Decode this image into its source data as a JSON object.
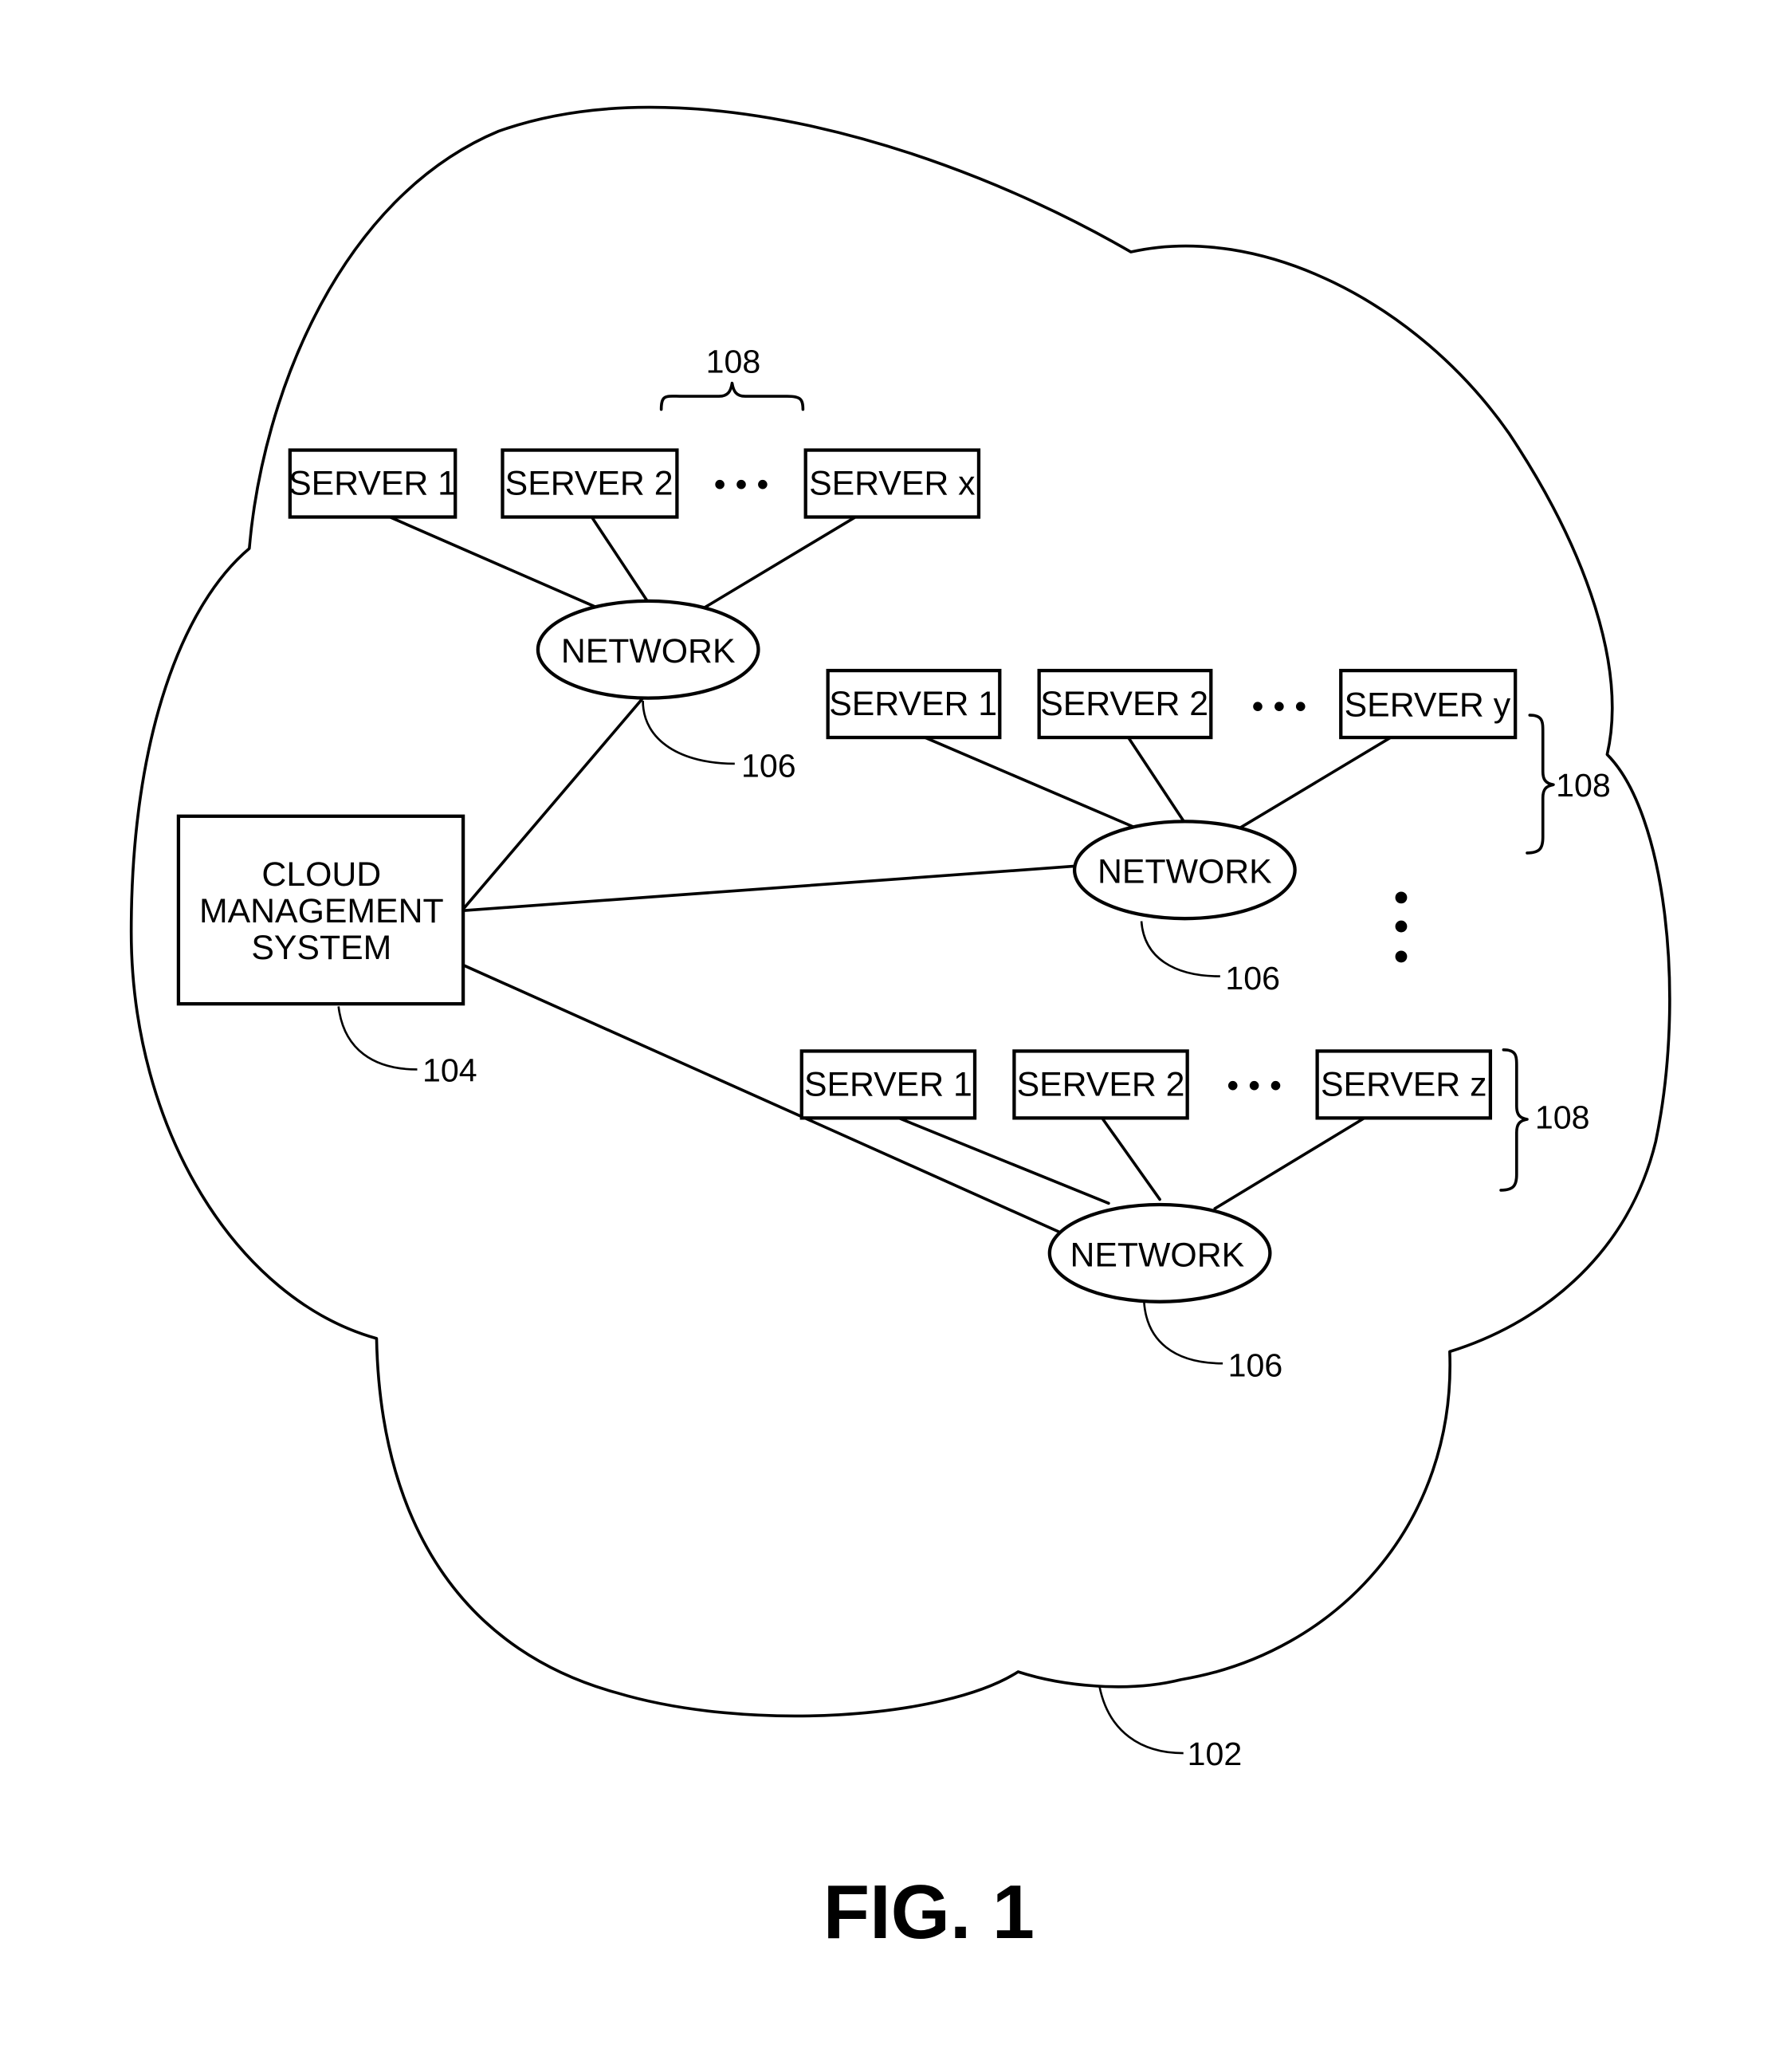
{
  "figure": {
    "caption": "FIG. 1",
    "cloud_ref": "102",
    "cloud_management_system": {
      "lines": [
        "CLOUD",
        "MANAGEMENT",
        "SYSTEM"
      ],
      "ref": "104"
    },
    "groups": [
      {
        "servers": [
          "SERVER 1",
          "SERVER 2",
          "SERVER x"
        ],
        "network_label": "NETWORK",
        "network_ref": "106",
        "group_ref": "108"
      },
      {
        "servers": [
          "SERVER 1",
          "SERVER 2",
          "SERVER y"
        ],
        "network_label": "NETWORK",
        "network_ref": "106",
        "group_ref": "108"
      },
      {
        "servers": [
          "SERVER 1",
          "SERVER 2",
          "SERVER z"
        ],
        "network_label": "NETWORK",
        "network_ref": "106",
        "group_ref": "108"
      }
    ],
    "ellipsis": "• • •"
  }
}
